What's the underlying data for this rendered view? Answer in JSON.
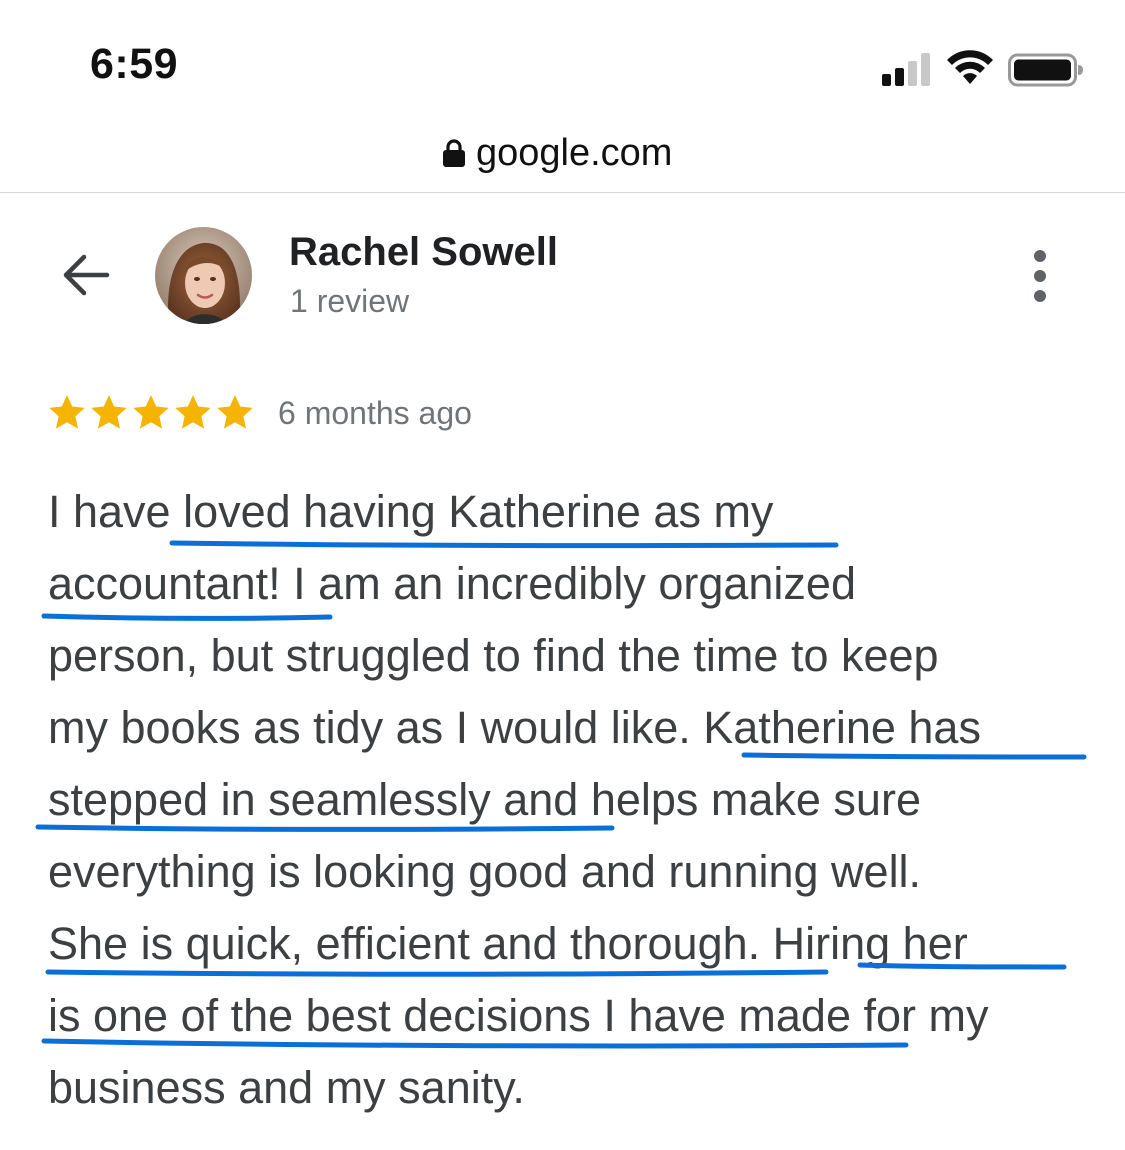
{
  "status_bar": {
    "time": "6:59"
  },
  "browser": {
    "url": "google.com"
  },
  "review": {
    "reviewer_name": "Rachel Sowell",
    "review_count": "1 review",
    "rating": 5,
    "rating_max": 5,
    "date": "6 months ago",
    "lines": [
      "I have loved having Katherine as my",
      "accountant! I am an incredibly organized",
      "person, but struggled to find the time to keep",
      "my books as tidy as I would like. Katherine has",
      "stepped in seamlessly and helps make sure",
      "everything is looking good and running well.",
      "She is quick, efficient and thorough. Hiring her",
      "is one of the best decisions I have made for my",
      "business and my sanity."
    ]
  },
  "icons": {
    "back": "arrow-left-icon",
    "more": "more-vert-icon",
    "lock": "lock-icon",
    "star": "star-icon"
  },
  "colors": {
    "star": "#F4B400",
    "underline": "#0A6FD6",
    "secondary_text": "#70757a",
    "body_text": "#3c4043"
  }
}
